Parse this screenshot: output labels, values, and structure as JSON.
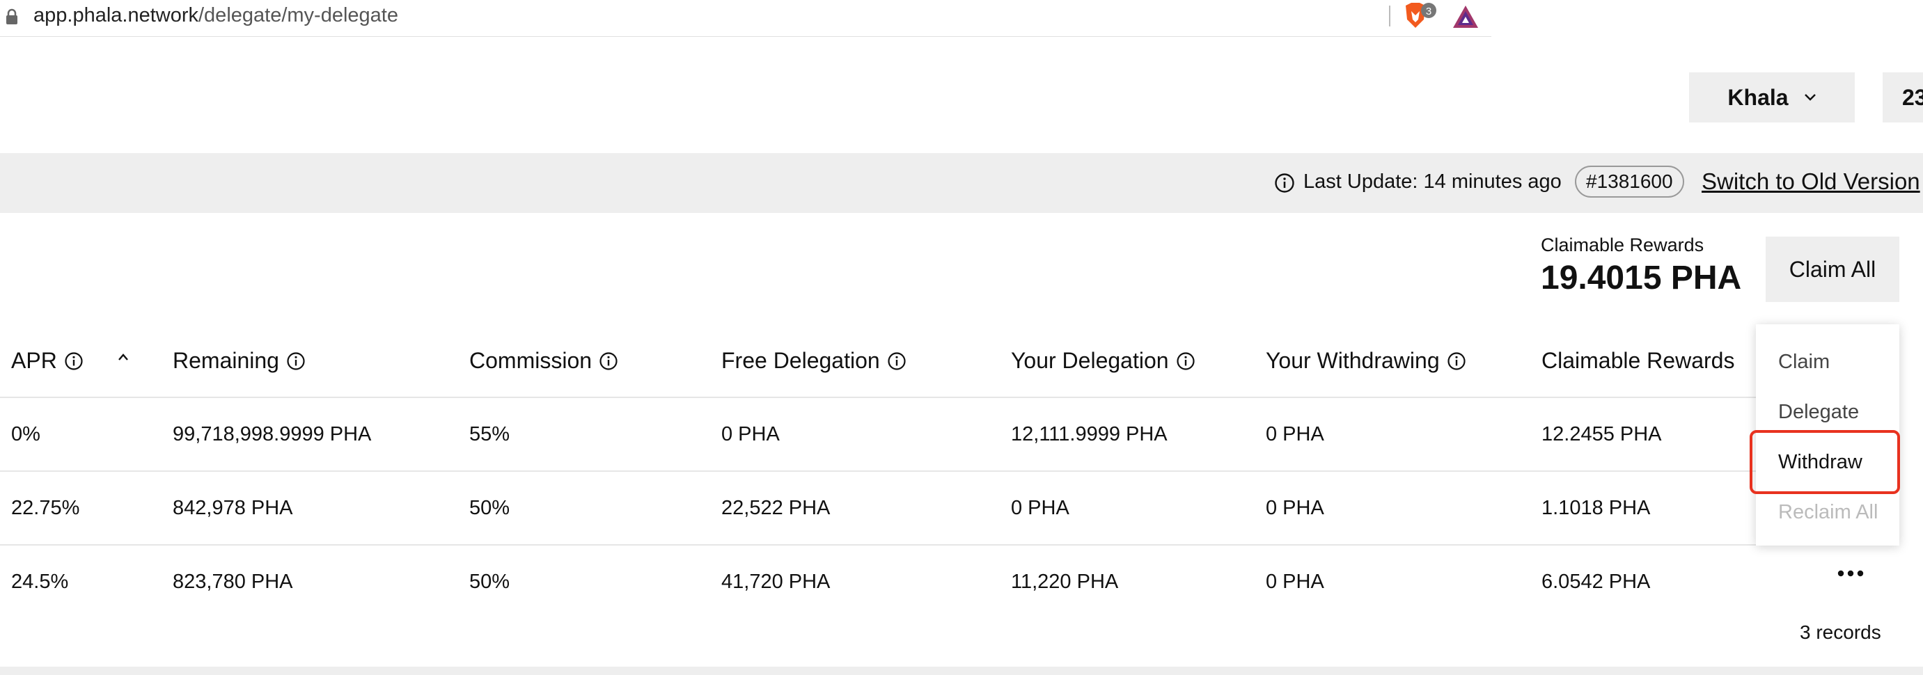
{
  "browser": {
    "url_host": "app.phala.network",
    "url_path": "/delegate/my-delegate",
    "brave_badge_count": "3"
  },
  "header": {
    "network": "Khala",
    "account_partial": "23"
  },
  "update_bar": {
    "last_update": "Last Update: 14 minutes ago",
    "block": "#1381600",
    "switch_link": "Switch to Old Version"
  },
  "summary": {
    "claimable_label": "Claimable Rewards",
    "claimable_amount": "19.4015 PHA",
    "claim_all": "Claim All"
  },
  "table": {
    "headers": [
      "APR",
      "Remaining",
      "Commission",
      "Free Delegation",
      "Your Delegation",
      "Your Withdrawing",
      "Claimable Rewards"
    ],
    "rows": [
      [
        "0%",
        "99,718,998.9999 PHA",
        "55%",
        "0 PHA",
        "12,111.9999 PHA",
        "0 PHA",
        "12.2455 PHA"
      ],
      [
        "22.75%",
        "842,978 PHA",
        "50%",
        "22,522 PHA",
        "0 PHA",
        "0 PHA",
        "1.1018 PHA"
      ],
      [
        "24.5%",
        "823,780 PHA",
        "50%",
        "41,720 PHA",
        "11,220 PHA",
        "0 PHA",
        "6.0542 PHA"
      ]
    ],
    "records": "3 records"
  },
  "menu": {
    "items": [
      "Claim",
      "Delegate",
      "Withdraw",
      "Reclaim All"
    ],
    "highlight_color": "#e8321f"
  }
}
